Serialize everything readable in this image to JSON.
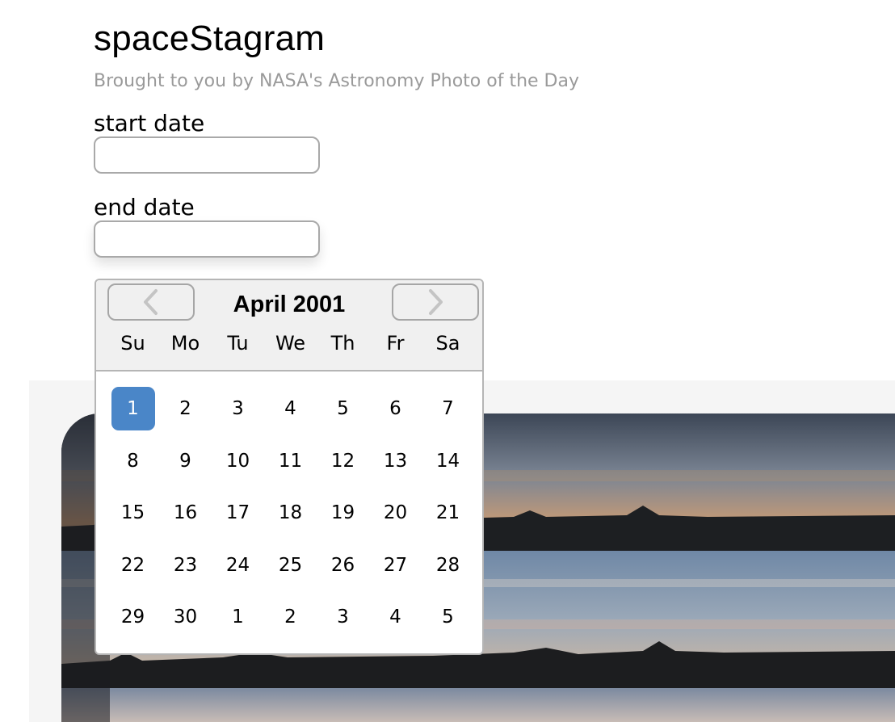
{
  "app": {
    "title": "spaceStagram",
    "subtitle": "Brought to you by NASA's Astronomy Photo of the Day"
  },
  "form": {
    "start_label": "start date",
    "start_value": "",
    "end_label": "end date",
    "end_value": ""
  },
  "datepicker": {
    "month_label": "April 2001",
    "prev_icon": "chevron-left-icon",
    "next_icon": "chevron-right-icon",
    "weekdays": [
      "Su",
      "Mo",
      "Tu",
      "We",
      "Th",
      "Fr",
      "Sa"
    ],
    "weeks": [
      [
        "1",
        "2",
        "3",
        "4",
        "5",
        "6",
        "7"
      ],
      [
        "8",
        "9",
        "10",
        "11",
        "12",
        "13",
        "14"
      ],
      [
        "15",
        "16",
        "17",
        "18",
        "19",
        "20",
        "21"
      ],
      [
        "22",
        "23",
        "24",
        "25",
        "26",
        "27",
        "28"
      ],
      [
        "29",
        "30",
        "1",
        "2",
        "3",
        "4",
        "5"
      ]
    ],
    "selected_day": "1",
    "accent_color": "#4a86c8"
  },
  "gallery": {
    "background_color": "#f5f5f5"
  }
}
